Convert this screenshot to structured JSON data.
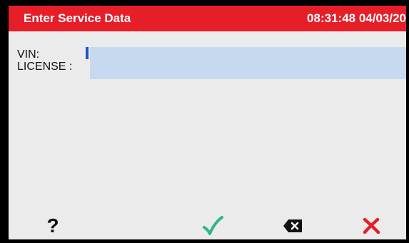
{
  "header": {
    "title": "Enter Service Data",
    "clock": "08:31:48 04/03/20"
  },
  "form": {
    "vin_label": "VIN:",
    "vin_value": "",
    "license_label": "LICENSE :",
    "license_value": ""
  },
  "softkeys": [
    {
      "icon": "question-mark-icon",
      "glyph": "?"
    },
    {
      "icon": "checkmark-icon",
      "color": "#2fb58b"
    },
    {
      "icon": "backspace-icon",
      "color": "#111111"
    },
    {
      "icon": "cross-icon",
      "color": "#e61e28"
    }
  ],
  "colors": {
    "titlebar": "#e61e28",
    "input_background": "#c6d9ef",
    "screen_background": "#ebebeb"
  }
}
